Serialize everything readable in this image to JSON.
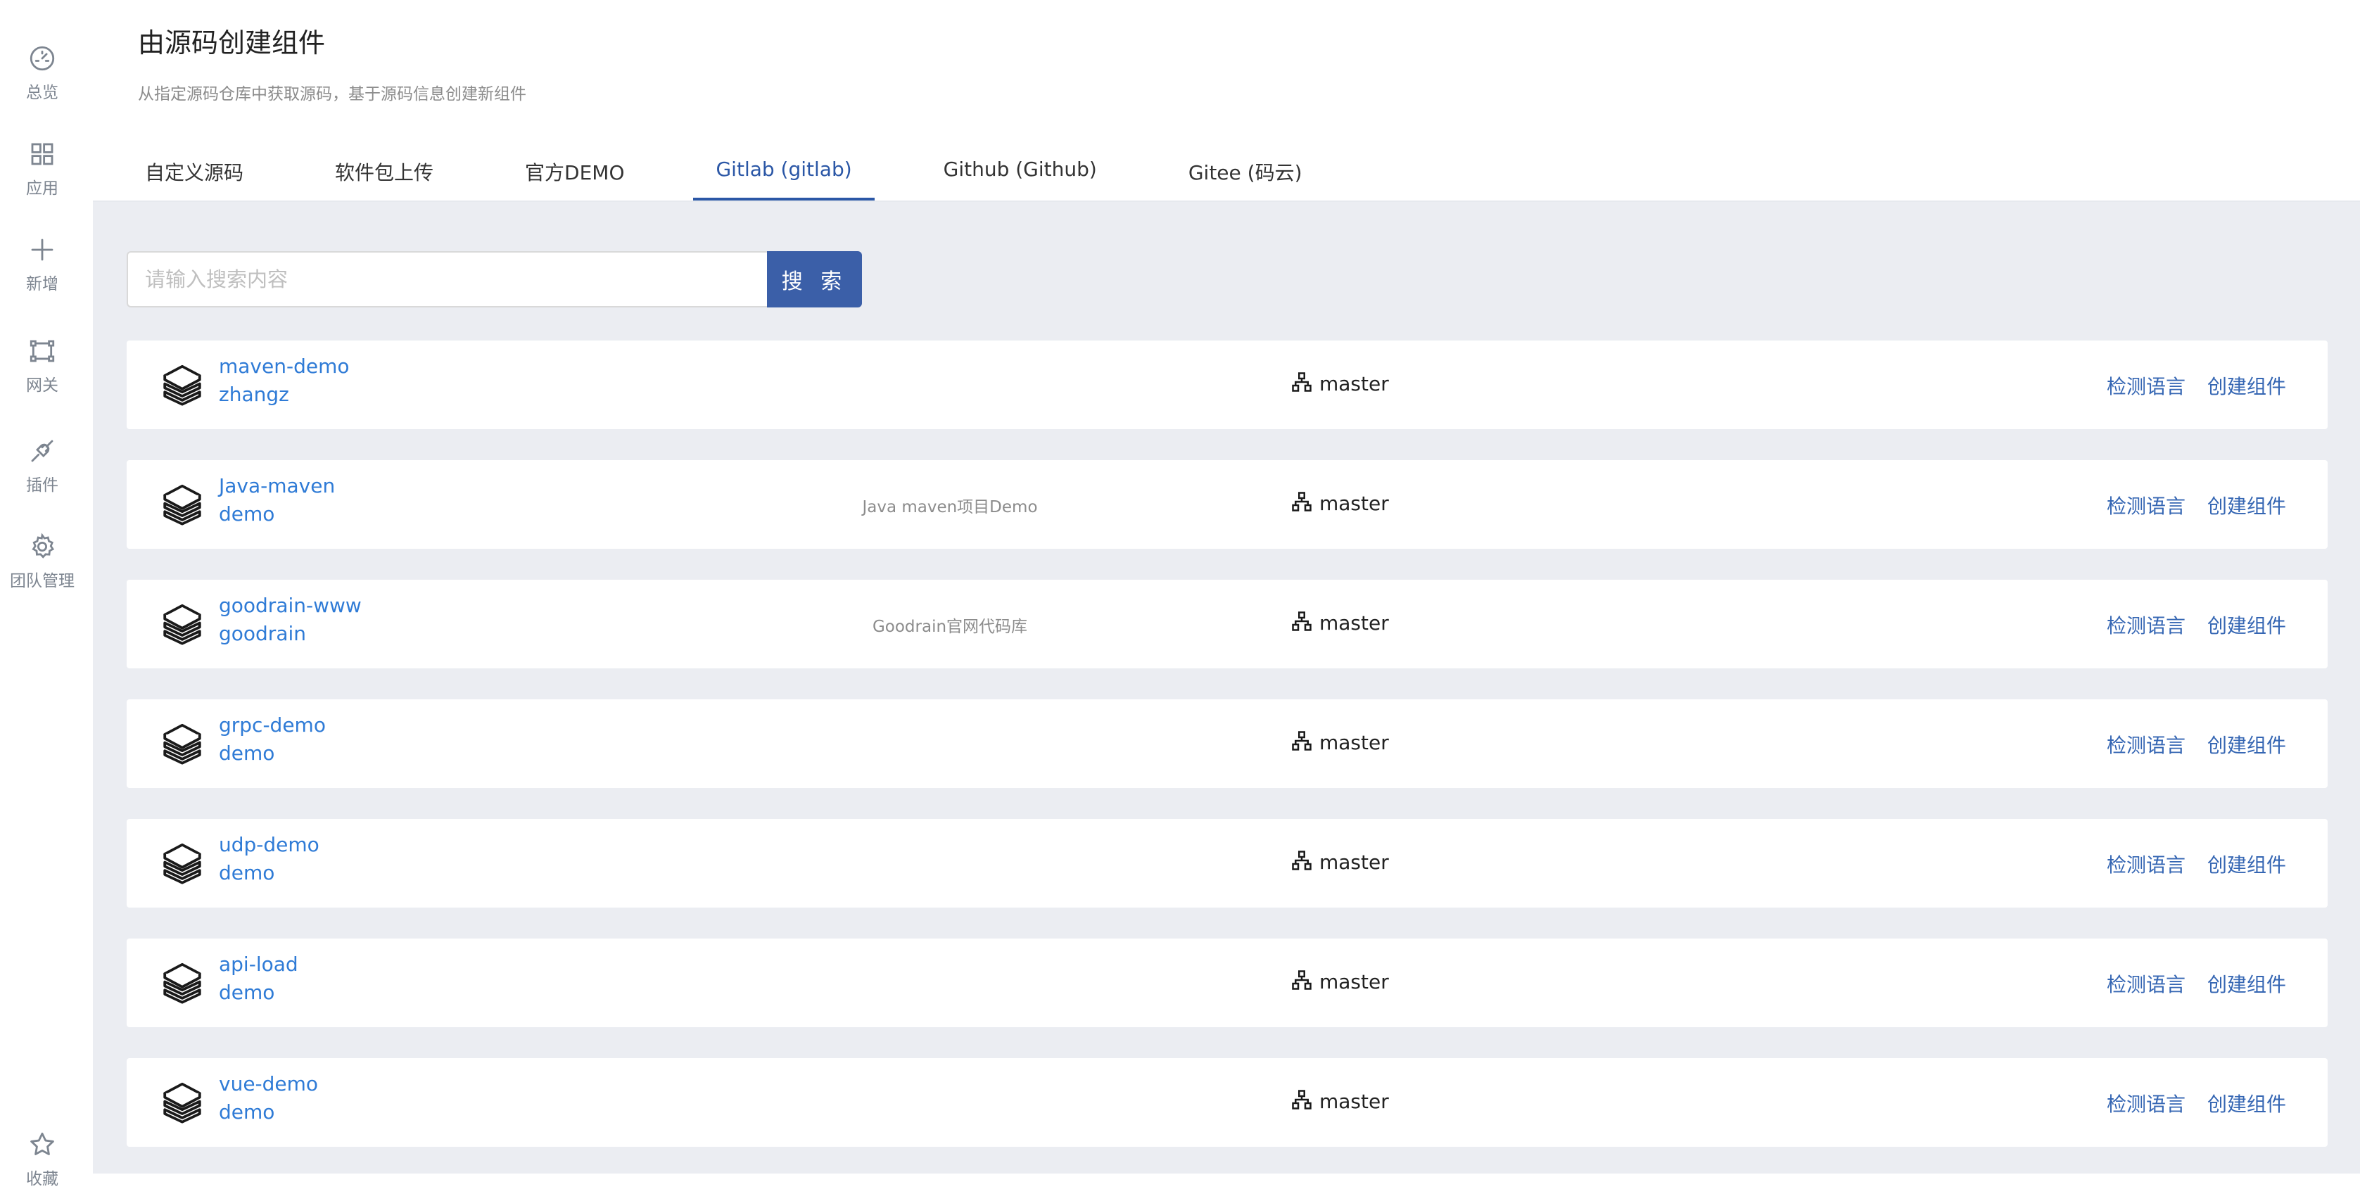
{
  "sidebar": {
    "items": [
      {
        "label": "总览",
        "icon": "dashboard-icon"
      },
      {
        "label": "应用",
        "icon": "apps-grid-icon"
      },
      {
        "label": "新增",
        "icon": "plus-icon"
      },
      {
        "label": "网关",
        "icon": "gateway-icon"
      },
      {
        "label": "插件",
        "icon": "plugin-icon"
      },
      {
        "label": "团队管理",
        "icon": "gear-icon"
      }
    ],
    "bottom": {
      "label": "收藏",
      "icon": "star-icon"
    }
  },
  "header": {
    "title": "由源码创建组件",
    "description": "从指定源码仓库中获取源码，基于源码信息创建新组件"
  },
  "tabs": [
    {
      "label": "自定义源码",
      "active": false
    },
    {
      "label": "软件包上传",
      "active": false
    },
    {
      "label": "官方DEMO",
      "active": false
    },
    {
      "label": "Gitlab (gitlab)",
      "active": true
    },
    {
      "label": "Github (Github)",
      "active": false
    },
    {
      "label": "Gitee (码云)",
      "active": false
    }
  ],
  "search": {
    "placeholder": "请输入搜索内容",
    "value": "",
    "button_label": "搜 索"
  },
  "repos": [
    {
      "name": "maven-demo",
      "owner": "zhangz",
      "description": "",
      "branch": "master"
    },
    {
      "name": "Java-maven",
      "owner": "demo",
      "description": "Java maven项目Demo",
      "branch": "master"
    },
    {
      "name": "goodrain-www",
      "owner": "goodrain",
      "description": "Goodrain官网代码库",
      "branch": "master"
    },
    {
      "name": "grpc-demo",
      "owner": "demo",
      "description": "",
      "branch": "master"
    },
    {
      "name": "udp-demo",
      "owner": "demo",
      "description": "",
      "branch": "master"
    },
    {
      "name": "api-load",
      "owner": "demo",
      "description": "",
      "branch": "master"
    },
    {
      "name": "vue-demo",
      "owner": "demo",
      "description": "",
      "branch": "master"
    }
  ],
  "actions": {
    "detect_language": "检测语言",
    "create_component": "创建组件"
  },
  "colors": {
    "accent": "#2b57a6",
    "link": "#2f7bd6",
    "search_button": "#3b5fa8",
    "main_bg": "#ebedf2"
  }
}
